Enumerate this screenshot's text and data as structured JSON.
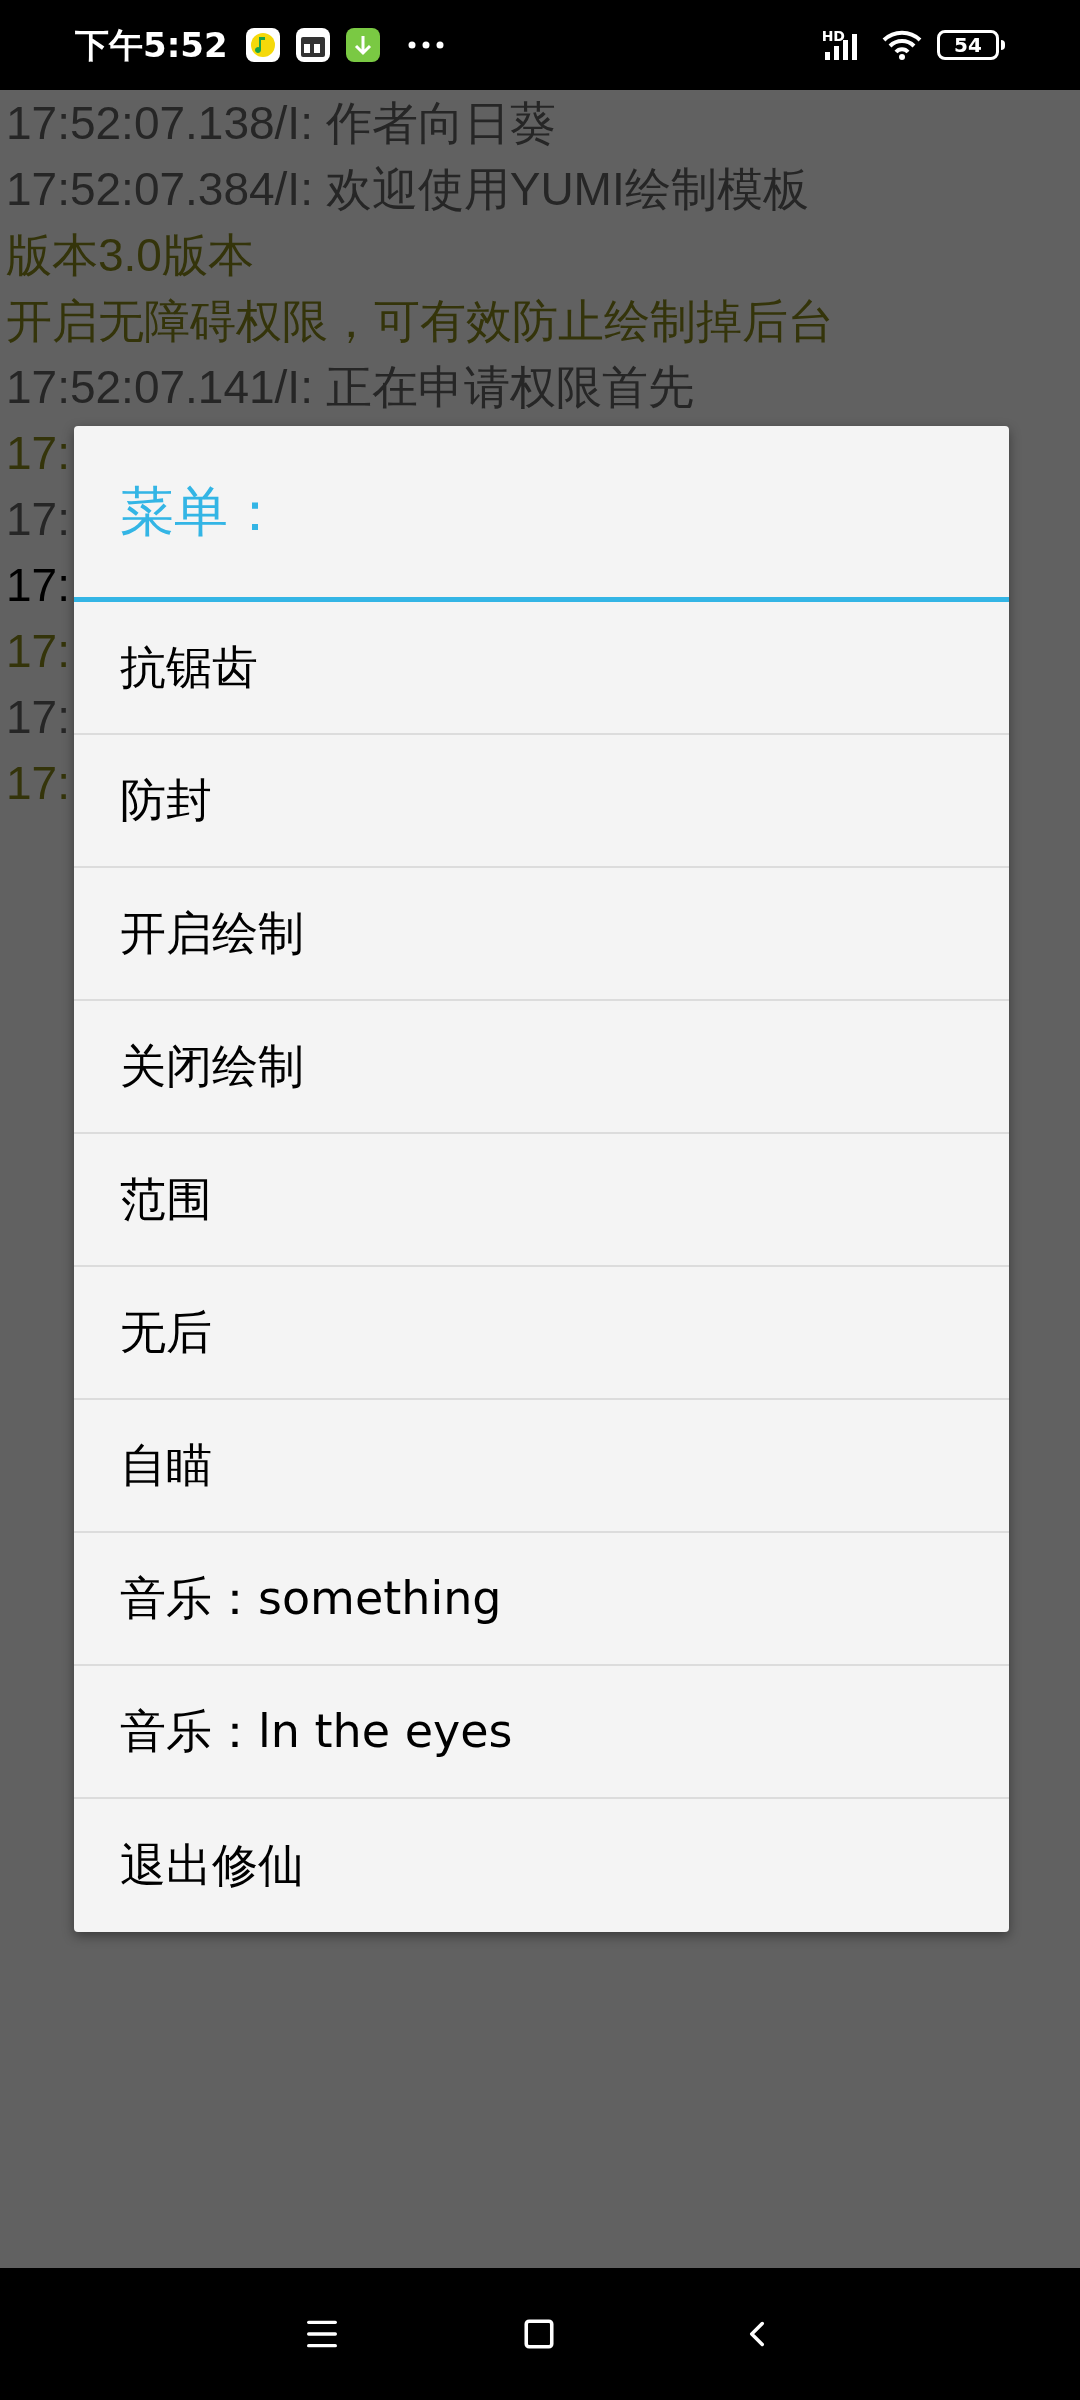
{
  "status_bar": {
    "time": "下午5:52",
    "battery": "54",
    "network": "HD"
  },
  "log": [
    {
      "text": "17:52:07.138/I: 作者向日葵",
      "color": "#262626"
    },
    {
      "text": "17:52:07.384/I: 欢迎使用YUMI绘制模板",
      "color": "#262626"
    },
    {
      "text": "版本3.0版本",
      "color": "#34340a"
    },
    {
      "text": "开启无障碍权限，可有效防止绘制掉后台",
      "color": "#34340a"
    },
    {
      "text": "17:52:07.141/I: 正在申请权限首先",
      "color": "#262626"
    },
    {
      "text": "17:",
      "color": "#34340a"
    },
    {
      "text": "17:",
      "color": "#262626"
    },
    {
      "text": "17:",
      "color": "#000000"
    },
    {
      "text": "17:",
      "color": "#34340a"
    },
    {
      "text": "17:",
      "color": "#262626"
    },
    {
      "text": "17:",
      "color": "#34340a"
    }
  ],
  "dialog": {
    "title": "菜单：",
    "items": [
      "抗锯齿",
      "防封",
      "开启绘制",
      "关闭绘制",
      "范围",
      "无后",
      "自瞄",
      "音乐：something",
      "音乐：ln the eyes",
      "退出修仙"
    ]
  }
}
